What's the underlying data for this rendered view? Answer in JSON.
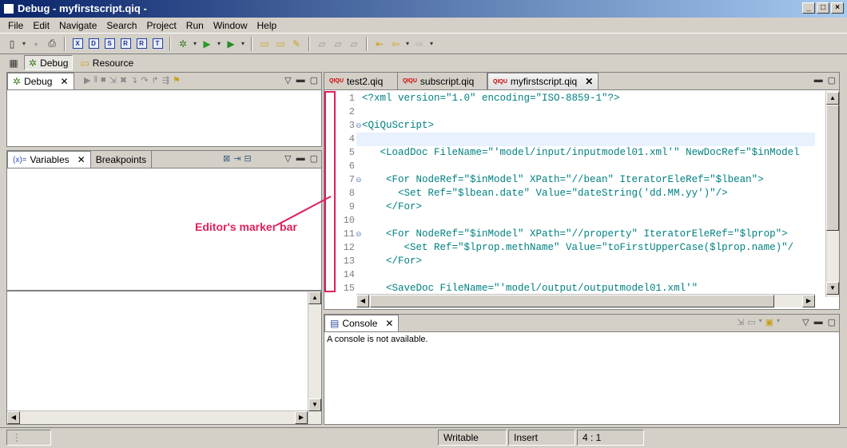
{
  "window": {
    "title": "Debug - myfirstscript.qiq -",
    "buttons": [
      "_",
      "□",
      "×"
    ]
  },
  "menu": [
    "File",
    "Edit",
    "Navigate",
    "Search",
    "Project",
    "Run",
    "Window",
    "Help"
  ],
  "perspectives": [
    {
      "label": "Debug",
      "active": true
    },
    {
      "label": "Resource",
      "active": false
    }
  ],
  "debug_view": {
    "tab": "Debug"
  },
  "variables_view": {
    "tabs": [
      "Variables",
      "Breakpoints"
    ]
  },
  "editor": {
    "tabs": [
      {
        "label": "test2.qiq",
        "icon": "QIQU"
      },
      {
        "label": "subscript.qiq",
        "icon": "QIQU"
      },
      {
        "label": "myfirstscript.qiq",
        "icon": "QIQU",
        "active": true
      }
    ],
    "lines": [
      {
        "n": "1",
        "text": "<?xml version=\"1.0\" encoding=\"ISO-8859-1\"?>"
      },
      {
        "n": "2",
        "text": ""
      },
      {
        "n": "3",
        "text": "<QiQuScript>",
        "fold": true
      },
      {
        "n": "4",
        "text": ""
      },
      {
        "n": "5",
        "text": "   <LoadDoc FileName=\"'model/input/inputmodel01.xml'\" NewDocRef=\"$inModel"
      },
      {
        "n": "6",
        "text": ""
      },
      {
        "n": "7",
        "text": "    <For NodeRef=\"$inModel\" XPath=\"//bean\" IteratorEleRef=\"$lbean\">",
        "fold": true
      },
      {
        "n": "8",
        "text": "      <Set Ref=\"$lbean.date\" Value=\"dateString('dd.MM.yy')\"/>"
      },
      {
        "n": "9",
        "text": "    </For>"
      },
      {
        "n": "10",
        "text": ""
      },
      {
        "n": "11",
        "text": "    <For NodeRef=\"$inModel\" XPath=\"//property\" IteratorEleRef=\"$lprop\">",
        "fold": true
      },
      {
        "n": "12",
        "text": "       <Set Ref=\"$lprop.methName\" Value=\"toFirstUpperCase($lprop.name)\"/"
      },
      {
        "n": "13",
        "text": "    </For>"
      },
      {
        "n": "14",
        "text": ""
      },
      {
        "n": "15",
        "text": "    <SaveDoc FileName=\"'model/output/outputmodel01.xml'\""
      }
    ]
  },
  "console": {
    "tab": "Console",
    "message": "A console is not available."
  },
  "annotation": "Editor's marker bar",
  "status": {
    "writable": "Writable",
    "mode": "Insert",
    "position": "4 : 1"
  }
}
